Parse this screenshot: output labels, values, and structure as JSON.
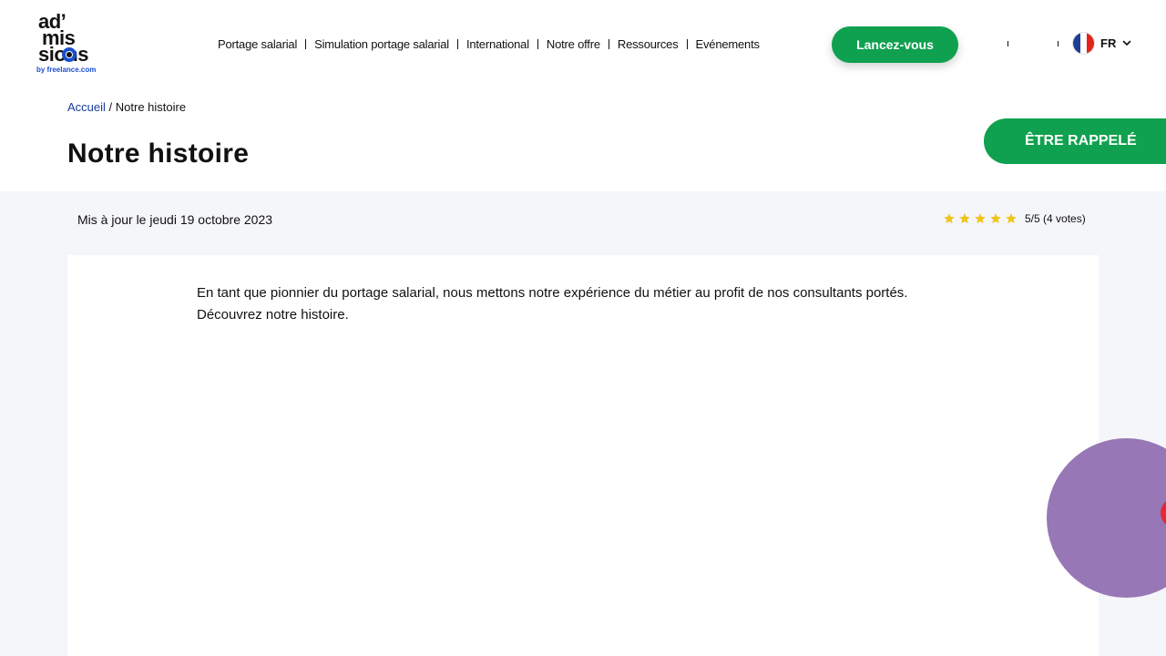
{
  "logo": {
    "line1": "ad’",
    "line2": "mis",
    "line3": "sions",
    "tagline": "by freelance.com"
  },
  "nav": {
    "items": [
      "Portage salarial",
      "Simulation portage salarial",
      "International",
      "Notre offre",
      "Ressources",
      "Evénements"
    ],
    "cta_label": "Lancez-vous"
  },
  "language": {
    "code": "FR",
    "flag_colors": [
      "#1c3f94",
      "#ffffff",
      "#e1251b"
    ]
  },
  "breadcrumb": {
    "home": "Accueil",
    "separator": " / ",
    "current": "Notre histoire"
  },
  "page": {
    "title": "Notre histoire",
    "callback_label": "ÊTRE RAPPELÉ",
    "updated": "Mis à jour le jeudi 19 octobre 2023",
    "rating": {
      "stars": 5,
      "max": 5,
      "text": "5/5 (4 votes)"
    },
    "intro": "En tant que pionnier du portage salarial, nous mettons notre expérience du métier au profit de nos consultants portés. Découvrez notre histoire."
  },
  "colors": {
    "accent_green": "#0fa14f",
    "link_blue": "#1a3f9e",
    "star_yellow": "#f0c419",
    "band_grey": "#f5f6fa",
    "blob_purple": "#9777b5",
    "blob_red": "#e8253a"
  }
}
